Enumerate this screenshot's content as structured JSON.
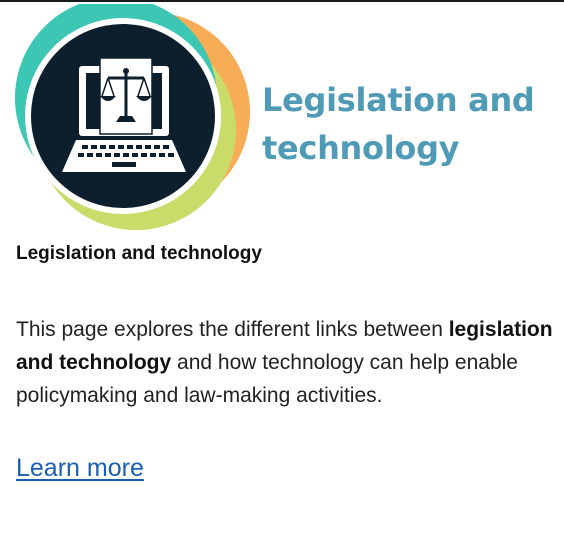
{
  "banner": {
    "title_line1": "Legislation and",
    "title_line2": "technology",
    "logo_icon": "laptop-with-scales-of-justice-icon"
  },
  "card": {
    "heading": "Legislation and technology",
    "description_prefix": "This page explores the different links between",
    "description_bold": "legislation and technology",
    "description_suffix": "and how technology can help enable policymaking and law-making activities.",
    "link_label": "Learn more"
  },
  "colors": {
    "title_teal": "#4f9bb7",
    "ring_teal": "#3cc6b4",
    "ring_orange": "#f7ad55",
    "ring_lime": "#c9dc6a",
    "circle_navy": "#0d1e2c",
    "link_blue": "#1a5fb4"
  }
}
